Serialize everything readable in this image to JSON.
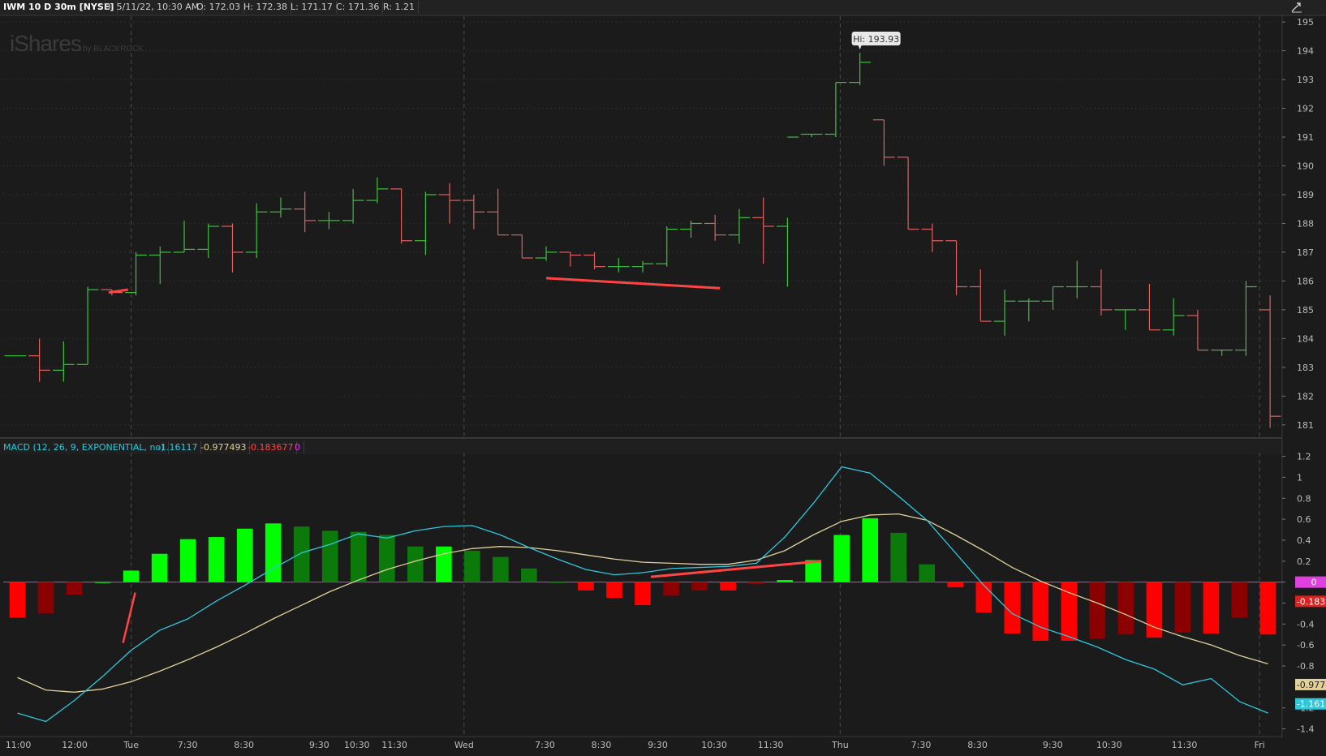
{
  "header": {
    "symbol": "IWM 10 D 30m [NYSE]",
    "date": "D: 5/11/22, 10:30 AM",
    "open": "O: 172.03",
    "high": "H: 172.38",
    "low": "L: 171.17",
    "close": "C: 171.36",
    "range": "R: 1.21"
  },
  "watermark": {
    "brand": "iShares",
    "by": "by BLACKROCK"
  },
  "macd_header": {
    "label": "MACD (12, 26, 9, EXPONENTIAL, no)",
    "value": "-1.16117",
    "avg": "-0.977493",
    "diff": "-0.183677",
    "zero": "0"
  },
  "colors": {
    "background": "#1b1b1b",
    "up": "#3fbf3f",
    "down": "#e06060",
    "macd_value": "#2ec8dc",
    "macd_avg": "#e0d09a",
    "hist_up_strong": "#00ff00",
    "hist_up_weak": "#0b7a0b",
    "hist_down_strong": "#ff0000",
    "hist_down_weak": "#8b0000",
    "zero_line": "#cc44cc",
    "annotation": "#ff4444"
  },
  "chart_data": [
    {
      "type": "ohlc",
      "title": "IWM 10 D 30m [NYSE]",
      "y_axis_ticks": [
        181,
        182,
        183,
        184,
        185,
        186,
        187,
        188,
        189,
        190,
        191,
        192,
        193,
        194,
        195
      ],
      "ylim": [
        180.6,
        195.2
      ],
      "x_tick_labels": [
        "11:00",
        "12:00",
        "Tue",
        "7:30",
        "8:30",
        "9:30",
        "10:30",
        "11:30",
        "Wed",
        "7:30",
        "8:30",
        "9:30",
        "10:30",
        "11:30",
        "Thu",
        "7:30",
        "8:30",
        "9:30",
        "10:30",
        "11:30",
        "Fri"
      ],
      "high_label": "Hi: 193.93",
      "bars": [
        {
          "o": 183.4,
          "h": 183.4,
          "l": 183.4,
          "c": 183.4
        },
        {
          "o": 183.4,
          "h": 184.0,
          "l": 182.5,
          "c": 182.9
        },
        {
          "o": 182.9,
          "h": 183.9,
          "l": 182.5,
          "c": 183.1
        },
        {
          "o": 183.1,
          "h": 185.8,
          "l": 183.1,
          "c": 185.7
        },
        {
          "o": 185.7,
          "h": 185.7,
          "l": 185.5,
          "c": 185.6
        },
        {
          "o": 185.6,
          "h": 187.0,
          "l": 185.5,
          "c": 186.9
        },
        {
          "o": 186.9,
          "h": 187.2,
          "l": 185.9,
          "c": 187.0
        },
        {
          "o": 187.0,
          "h": 188.1,
          "l": 187.0,
          "c": 187.1
        },
        {
          "o": 187.1,
          "h": 188.0,
          "l": 186.8,
          "c": 187.9
        },
        {
          "o": 187.9,
          "h": 188.0,
          "l": 186.3,
          "c": 187.0
        },
        {
          "o": 187.0,
          "h": 188.7,
          "l": 186.8,
          "c": 188.4
        },
        {
          "o": 188.4,
          "h": 188.9,
          "l": 188.2,
          "c": 188.5
        },
        {
          "o": 188.5,
          "h": 189.1,
          "l": 187.7,
          "c": 188.1
        },
        {
          "o": 188.1,
          "h": 188.4,
          "l": 187.8,
          "c": 188.1
        },
        {
          "o": 188.1,
          "h": 189.2,
          "l": 188.0,
          "c": 188.8
        },
        {
          "o": 188.8,
          "h": 189.6,
          "l": 188.7,
          "c": 189.2
        },
        {
          "o": 189.2,
          "h": 189.2,
          "l": 187.3,
          "c": 187.4
        },
        {
          "o": 187.4,
          "h": 189.1,
          "l": 186.9,
          "c": 189.0
        },
        {
          "o": 189.0,
          "h": 189.4,
          "l": 188.0,
          "c": 188.8
        },
        {
          "o": 188.8,
          "h": 189.0,
          "l": 187.8,
          "c": 188.4
        },
        {
          "o": 188.4,
          "h": 189.2,
          "l": 187.6,
          "c": 187.6
        },
        {
          "o": 187.6,
          "h": 187.6,
          "l": 186.8,
          "c": 186.8
        },
        {
          "o": 186.8,
          "h": 187.2,
          "l": 186.7,
          "c": 187.0
        },
        {
          "o": 187.0,
          "h": 187.0,
          "l": 186.5,
          "c": 186.9
        },
        {
          "o": 186.9,
          "h": 187.0,
          "l": 186.4,
          "c": 186.5
        },
        {
          "o": 186.5,
          "h": 186.8,
          "l": 186.3,
          "c": 186.5
        },
        {
          "o": 186.5,
          "h": 186.7,
          "l": 186.3,
          "c": 186.6
        },
        {
          "o": 186.6,
          "h": 187.9,
          "l": 186.5,
          "c": 187.8
        },
        {
          "o": 187.8,
          "h": 188.1,
          "l": 187.5,
          "c": 188.0
        },
        {
          "o": 188.0,
          "h": 188.3,
          "l": 187.4,
          "c": 187.6
        },
        {
          "o": 187.6,
          "h": 188.5,
          "l": 187.3,
          "c": 188.2
        },
        {
          "o": 188.2,
          "h": 188.9,
          "l": 186.6,
          "c": 187.9
        },
        {
          "o": 187.9,
          "h": 188.2,
          "l": 185.8,
          "c": 191.0
        },
        {
          "o": 191.1,
          "h": 191.1,
          "l": 191.0,
          "c": 191.1
        },
        {
          "o": 191.1,
          "h": 192.9,
          "l": 191.0,
          "c": 192.9
        },
        {
          "o": 192.9,
          "h": 193.93,
          "l": 192.8,
          "c": 193.6
        },
        {
          "o": 191.6,
          "h": 191.6,
          "l": 190.0,
          "c": 190.3
        },
        {
          "o": 190.3,
          "h": 190.3,
          "l": 187.8,
          "c": 187.8
        },
        {
          "o": 187.8,
          "h": 188.0,
          "l": 187.0,
          "c": 187.4
        },
        {
          "o": 187.4,
          "h": 187.4,
          "l": 185.5,
          "c": 185.8
        },
        {
          "o": 185.8,
          "h": 186.4,
          "l": 184.6,
          "c": 184.6
        },
        {
          "o": 184.6,
          "h": 185.7,
          "l": 184.1,
          "c": 185.3
        },
        {
          "o": 185.3,
          "h": 185.4,
          "l": 184.6,
          "c": 185.3
        },
        {
          "o": 185.3,
          "h": 185.8,
          "l": 185.0,
          "c": 185.8
        },
        {
          "o": 185.8,
          "h": 186.7,
          "l": 185.4,
          "c": 185.8
        },
        {
          "o": 185.8,
          "h": 186.4,
          "l": 184.8,
          "c": 185.0
        },
        {
          "o": 185.0,
          "h": 185.0,
          "l": 184.3,
          "c": 185.0
        },
        {
          "o": 185.0,
          "h": 185.9,
          "l": 184.3,
          "c": 184.3
        },
        {
          "o": 184.3,
          "h": 185.4,
          "l": 184.1,
          "c": 184.8
        },
        {
          "o": 184.8,
          "h": 185.0,
          "l": 183.6,
          "c": 183.6
        },
        {
          "o": 183.6,
          "h": 183.6,
          "l": 183.4,
          "c": 183.6
        },
        {
          "o": 183.6,
          "h": 186.0,
          "l": 183.4,
          "c": 185.8
        },
        {
          "o": 185.0,
          "h": 185.5,
          "l": 180.9,
          "c": 181.3
        }
      ]
    },
    {
      "type": "macd",
      "title": "MACD (12, 26, 9, EXPONENTIAL, no)",
      "y_axis_ticks": [
        1.2,
        1.0,
        0.8,
        0.6,
        0.4,
        0.2,
        0,
        -0.2,
        -0.4,
        -0.6,
        -0.8,
        -1.2,
        -1.4
      ],
      "ylim": [
        -1.45,
        1.22
      ],
      "current_labels": {
        "diff": "-0.1836",
        "avg": "-0.9774",
        "value": "-1.1612",
        "zero": "0"
      },
      "histogram": [
        -0.34,
        -0.3,
        -0.12,
        0,
        0.11,
        0.27,
        0.41,
        0.43,
        0.51,
        0.56,
        0.53,
        0.49,
        0.48,
        0.45,
        0.34,
        0.34,
        0.3,
        0.24,
        0.13,
        0,
        -0.08,
        -0.15,
        -0.22,
        -0.13,
        -0.08,
        -0.08,
        -0.02,
        0.02,
        0.21,
        0.45,
        0.61,
        0.47,
        0.17,
        -0.05,
        -0.29,
        -0.49,
        -0.56,
        -0.56,
        -0.54,
        -0.5,
        -0.53,
        -0.48,
        -0.49,
        -0.34,
        -0.5
      ],
      "macd_value": [
        -1.25,
        -1.33,
        -1.13,
        -0.9,
        -0.65,
        -0.46,
        -0.35,
        -0.18,
        -0.03,
        0.13,
        0.28,
        0.36,
        0.46,
        0.42,
        0.49,
        0.53,
        0.54,
        0.45,
        0.33,
        0.22,
        0.12,
        0.07,
        0.09,
        0.13,
        0.14,
        0.15,
        0.18,
        0.43,
        0.75,
        1.1,
        1.04,
        0.82,
        0.59,
        0.28,
        -0.03,
        -0.3,
        -0.43,
        -0.52,
        -0.62,
        -0.74,
        -0.83,
        -0.98,
        -0.92,
        -1.14,
        -1.25
      ],
      "macd_avg": [
        -0.91,
        -1.03,
        -1.05,
        -1.02,
        -0.95,
        -0.85,
        -0.74,
        -0.62,
        -0.49,
        -0.35,
        -0.22,
        -0.09,
        0.02,
        0.12,
        0.2,
        0.27,
        0.32,
        0.34,
        0.33,
        0.3,
        0.26,
        0.22,
        0.19,
        0.18,
        0.17,
        0.17,
        0.21,
        0.3,
        0.45,
        0.58,
        0.64,
        0.65,
        0.59,
        0.45,
        0.3,
        0.14,
        0.01,
        -0.1,
        -0.2,
        -0.31,
        -0.43,
        -0.52,
        -0.6,
        -0.7,
        -0.78
      ]
    }
  ]
}
